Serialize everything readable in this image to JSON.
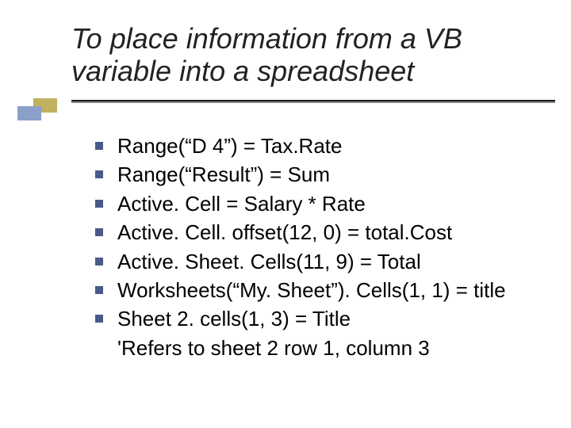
{
  "title": "To place information from a VB variable into a spreadsheet",
  "bullets": [
    "Range(“D 4”) = Tax.Rate",
    "Range(“Result”) = Sum",
    "Active. Cell = Salary * Rate",
    "Active. Cell. offset(12, 0) = total.Cost",
    "Active. Sheet. Cells(11, 9) = Total",
    "Worksheets(“My. Sheet”). Cells(1, 1) = title",
    "Sheet 2. cells(1, 3) = Title"
  ],
  "continuation": "'Refers to sheet 2 row 1, column 3"
}
